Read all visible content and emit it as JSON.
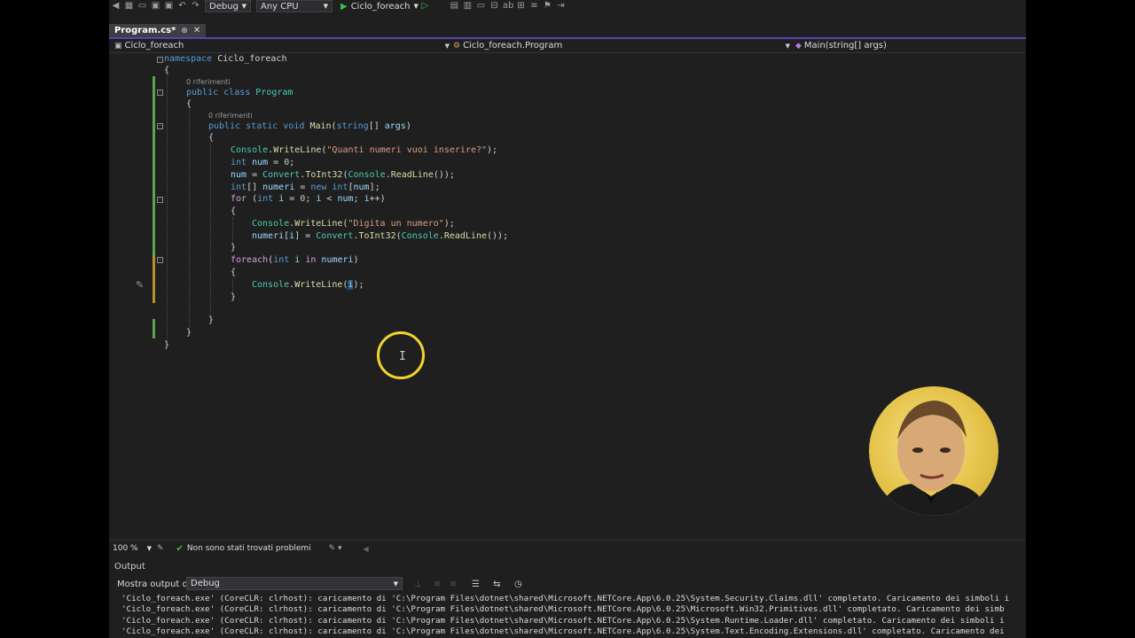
{
  "toolbar": {
    "config_label": "Debug",
    "platform_label": "Any CPU",
    "run_label": "Ciclo_foreach"
  },
  "tab": {
    "title": "Program.cs*"
  },
  "navbar": {
    "project": "Ciclo_foreach",
    "type": "Ciclo_foreach.Program",
    "member": "Main(string[] args)"
  },
  "code": {
    "references_label": "0 riferimenti"
  },
  "status": {
    "zoom": "100 %",
    "problems": "Non sono stati trovati problemi"
  },
  "output": {
    "title": "Output",
    "show_output_label": "Mostra output di:",
    "source": "Debug",
    "lines": [
      "'Ciclo_foreach.exe' (CoreCLR: clrhost): caricamento di 'C:\\Program Files\\dotnet\\shared\\Microsoft.NETCore.App\\6.0.25\\System.Security.Claims.dll' completato. Caricamento dei simboli i",
      "'Ciclo_foreach.exe' (CoreCLR: clrhost): caricamento di 'C:\\Program Files\\dotnet\\shared\\Microsoft.NETCore.App\\6.0.25\\Microsoft.Win32.Primitives.dll' completato. Caricamento dei simb",
      "'Ciclo_foreach.exe' (CoreCLR: clrhost): caricamento di 'C:\\Program Files\\dotnet\\shared\\Microsoft.NETCore.App\\6.0.25\\System.Runtime.Loader.dll' completato. Caricamento dei simboli i",
      "'Ciclo_foreach.exe' (CoreCLR: clrhost): caricamento di 'C:\\Program Files\\dotnet\\shared\\Microsoft.NETCore.App\\6.0.25\\System.Text.Encoding.Extensions.dll' completato. Caricamento dei"
    ]
  },
  "colors": {
    "editor_bg": "#1f1f1f",
    "keyword": "#569cd6",
    "type": "#4ec9b0",
    "method": "#dcdcaa",
    "string": "#d69d85",
    "variable": "#9cdcfe",
    "change_bar": "#57a64a",
    "cursor_ring": "#f2d52a"
  },
  "icons": [
    "solution-icon",
    "save-icon",
    "undo-icon",
    "run-icon",
    "pencil-icon",
    "check-icon",
    "clock-icon"
  ]
}
